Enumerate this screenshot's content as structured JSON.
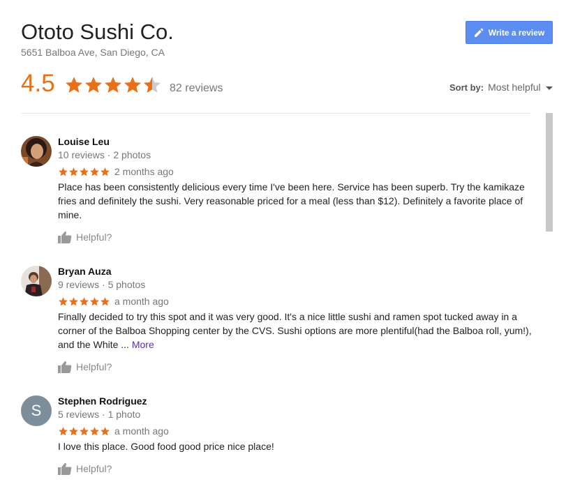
{
  "business": {
    "name": "Ototo Sushi Co.",
    "address": "5651 Balboa Ave, San Diego, CA",
    "rating": "4.5",
    "rating_value": 4.5,
    "review_count": "82 reviews",
    "write_review_label": "Write a review"
  },
  "sort": {
    "label": "Sort by:",
    "value": "Most helpful"
  },
  "colors": {
    "accent_orange": "#e7711b",
    "button_blue": "#5c8ef2",
    "more_link": "#5b2fa8"
  },
  "reviews": [
    {
      "name": "Louise Leu",
      "meta": "10 reviews · 2 photos",
      "stars": 5,
      "time": "2 months ago",
      "text": "Place has been consistently delicious every time I've been here. Service has been superb. Try the kamikaze fries and definitely the sushi. Very reasonable priced for a meal (less than $12). Definitely a favorite place of mine.",
      "more": "",
      "helpful": "Helpful?",
      "avatar": "photo"
    },
    {
      "name": "Bryan Auza",
      "meta": "9 reviews · 5 photos",
      "stars": 5,
      "time": "a month ago",
      "text": "Finally decided to try this spot and it was very good. It's a nice little sushi and ramen spot tucked away in a corner of the Balboa Shopping center by the CVS. Sushi options are more plentiful(had the Balboa roll, yum!), and the White ... ",
      "more": "More",
      "helpful": "Helpful?",
      "avatar": "photo"
    },
    {
      "name": "Stephen Rodriguez",
      "meta": "5 reviews · 1 photo",
      "stars": 5,
      "time": "a month ago",
      "text": "I love this place. Good food good price nice place!",
      "more": "",
      "helpful": "Helpful?",
      "avatar_initial": "S"
    }
  ]
}
